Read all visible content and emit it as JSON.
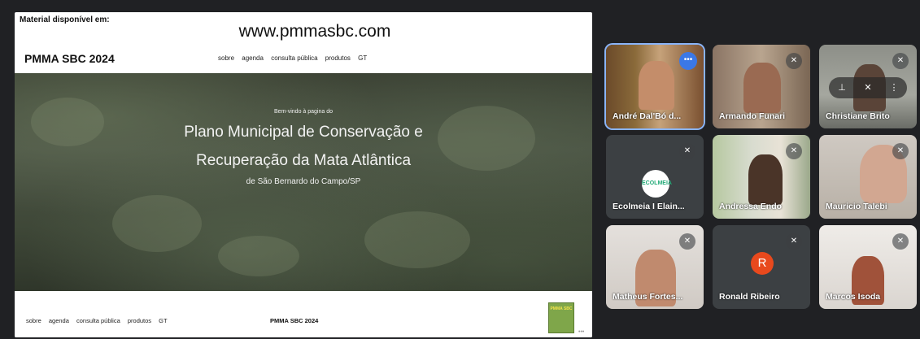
{
  "shared_screen": {
    "material_label": "Material disponível em:",
    "site_url": "www.pmmasbc.com",
    "brand": "PMMA SBC 2024",
    "nav_links": [
      "sobre",
      "agenda",
      "consulta pública",
      "produtos",
      "GT"
    ],
    "hero": {
      "welcome": "Bem-vindo à pagina do",
      "title_line1": "Plano Municipal de Conservação e",
      "title_line2": "Recuperação da Mata Atlântica",
      "subtitle": "de São Bernardo do Campo/SP"
    },
    "footer": {
      "links": [
        "sobre",
        "agenda",
        "consulta pública",
        "produtos",
        "GT"
      ],
      "brand": "PMMA SBC 2024",
      "logo_text": "PMMA SBC"
    }
  },
  "participants": [
    {
      "name": "André Dal'Bó d...",
      "muted": false,
      "active": true
    },
    {
      "name": "Armando Funari",
      "muted": true
    },
    {
      "name": "Christiane Brito",
      "muted": true
    },
    {
      "name": "Ecolmeia I Elain...",
      "muted": true,
      "avatar_text": "ECOLMEIA"
    },
    {
      "name": "Andressa Endo",
      "muted": true
    },
    {
      "name": "Mauricio Talebi",
      "muted": true
    },
    {
      "name": "Matheus Fortes...",
      "muted": true
    },
    {
      "name": "Ronald Ribeiro",
      "muted": true,
      "avatar_initial": "R"
    },
    {
      "name": "Marcos Isoda",
      "muted": true
    }
  ],
  "colors": {
    "background": "#202124",
    "tile": "#3c4043",
    "active_border": "#8ab4f8",
    "avatar_r": "#e8491d"
  }
}
